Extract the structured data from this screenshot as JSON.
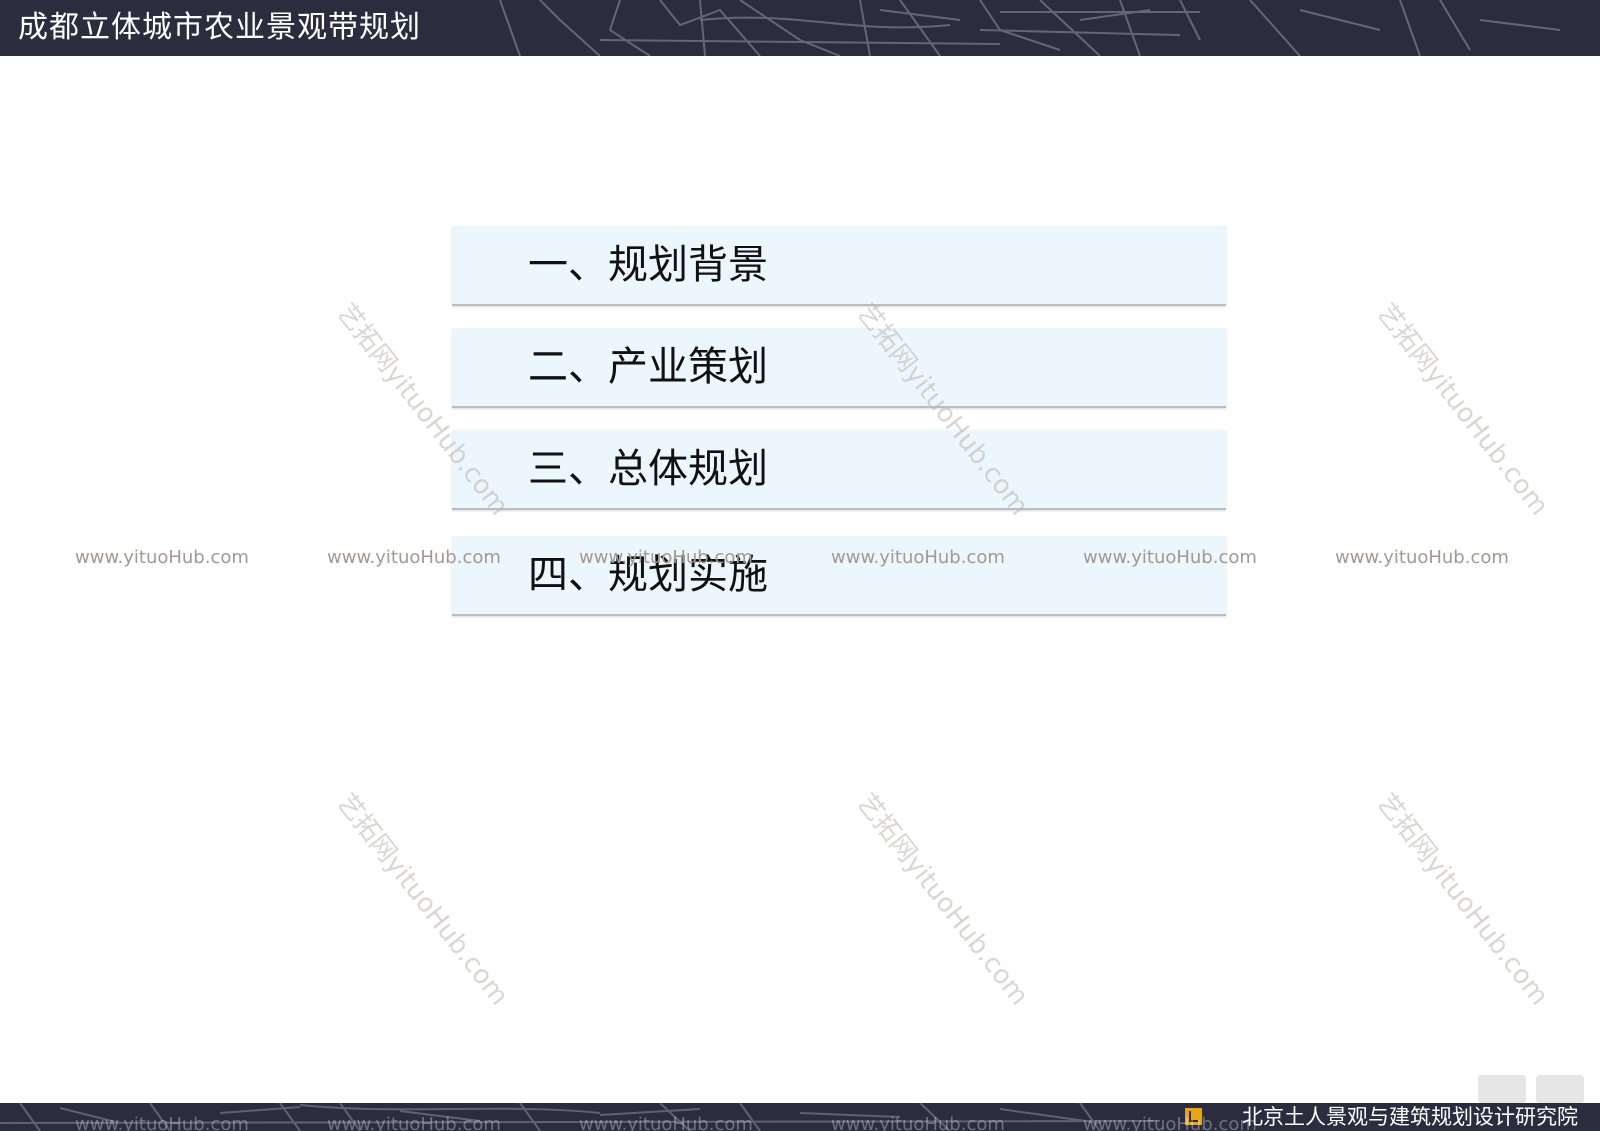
{
  "header": {
    "title": "成都立体城市农业景观带规划"
  },
  "menu": {
    "items": [
      {
        "label": "一、规划背景"
      },
      {
        "label": "二、产业策划"
      },
      {
        "label": "三、总体规划"
      },
      {
        "label": "四、规划实施"
      }
    ]
  },
  "footer": {
    "organization": "北京土人景观与建筑规划设计研究院"
  },
  "watermarks": {
    "url": "www.yituoHub.com",
    "diagonal": "艺拓网yituoHub.com"
  },
  "colors": {
    "bar_background": "#2b2d3f",
    "menu_background": "#ebf6fd",
    "logo_accent": "#e7a514"
  }
}
